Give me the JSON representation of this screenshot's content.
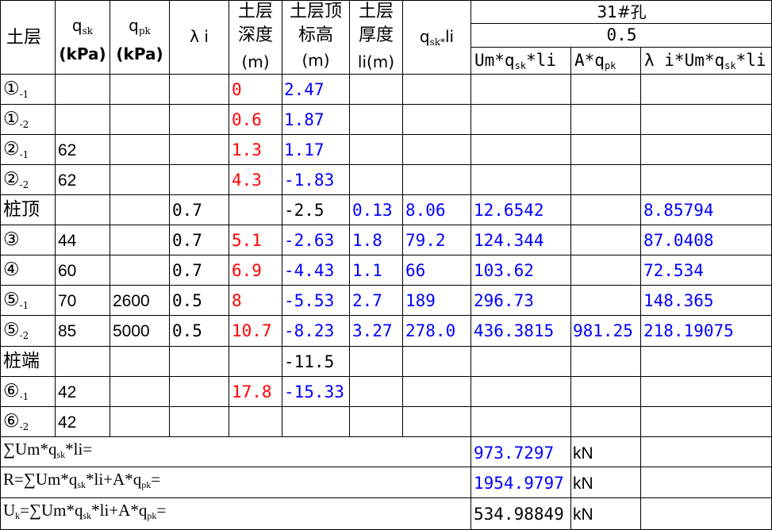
{
  "header": {
    "soil_layer": "土层",
    "qsk_top": "q",
    "qsk_sub": "sk",
    "qsk_unit": "(kPa)",
    "qpk_top": "q",
    "qpk_sub": "pk",
    "qpk_unit": "(kPa)",
    "lambda": "λ i",
    "depth_l1": "土层",
    "depth_l2": "深度",
    "depth_unit": "(m)",
    "elev_l1": "土层顶",
    "elev_l2": "标高",
    "elev_unit": "(m)",
    "thick_l1": "土层",
    "thick_l2": "厚度",
    "thick_unit": "li(m)",
    "qskli_q": "q",
    "qskli_sub": "sk*",
    "qskli_li": "li",
    "hole": "31#孔",
    "hole_value": "0.5",
    "col_um_pre": "Um*q",
    "col_um_sub": "sk",
    "col_um_post": "*li",
    "col_a_pre": "A*q",
    "col_a_sub": "pk",
    "col_lam": "λ i*Um*q",
    "col_lam_sub": "sk",
    "col_lam_post": "*li"
  },
  "rows": [
    {
      "sym": "①",
      "sub": "-1",
      "qsk": "",
      "qpk": "",
      "lam": "",
      "depth": "0",
      "elev": "2.47",
      "thick": "",
      "qskli": "",
      "um": "",
      "a": "",
      "lamum": ""
    },
    {
      "sym": "①",
      "sub": "-2",
      "qsk": "",
      "qpk": "",
      "lam": "",
      "depth": "0.6",
      "elev": "1.87",
      "thick": "",
      "qskli": "",
      "um": "",
      "a": "",
      "lamum": ""
    },
    {
      "sym": "②",
      "sub": "-1",
      "qsk": "62",
      "qpk": "",
      "lam": "",
      "depth": "1.3",
      "elev": "1.17",
      "thick": "",
      "qskli": "",
      "um": "",
      "a": "",
      "lamum": ""
    },
    {
      "sym": "②",
      "sub": "-2",
      "qsk": "62",
      "qpk": "",
      "lam": "",
      "depth": "4.3",
      "elev": "-1.83",
      "thick": "",
      "qskli": "",
      "um": "",
      "a": "",
      "lamum": ""
    },
    {
      "sym": "桩顶",
      "sub": "",
      "qsk": "",
      "qpk": "",
      "lam": "0.7",
      "depth": "",
      "elev": "-2.5",
      "thick": "0.13",
      "qskli": "8.06",
      "um": "12.6542",
      "a": "",
      "lamum": "8.85794"
    },
    {
      "sym": "③",
      "sub": "",
      "qsk": "44",
      "qpk": "",
      "lam": "0.7",
      "depth": "5.1",
      "elev": "-2.63",
      "thick": "1.8",
      "qskli": "79.2",
      "um": "124.344",
      "a": "",
      "lamum": "87.0408"
    },
    {
      "sym": "④",
      "sub": "",
      "qsk": "60",
      "qpk": "",
      "lam": "0.7",
      "depth": "6.9",
      "elev": "-4.43",
      "thick": "1.1",
      "qskli": "66",
      "um": "103.62",
      "a": "",
      "lamum": "72.534"
    },
    {
      "sym": "⑤",
      "sub": "-1",
      "qsk": "70",
      "qpk": "2600",
      "lam": "0.5",
      "depth": "8",
      "elev": "-5.53",
      "thick": "2.7",
      "qskli": "189",
      "um": "296.73",
      "a": "",
      "lamum": "148.365"
    },
    {
      "sym": "⑤",
      "sub": "-2",
      "qsk": "85",
      "qpk": "5000",
      "lam": "0.5",
      "depth": "10.7",
      "elev": "-8.23",
      "thick": "3.27",
      "qskli": "278.0",
      "um": "436.3815",
      "a": "981.25",
      "lamum": "218.19075"
    },
    {
      "sym": "桩端",
      "sub": "",
      "qsk": "",
      "qpk": "",
      "lam": "",
      "depth": "",
      "elev": "-11.5",
      "thick": "",
      "qskli": "",
      "um": "",
      "a": "",
      "lamum": ""
    },
    {
      "sym": "⑥",
      "sub": "-1",
      "qsk": "42",
      "qpk": "",
      "lam": "",
      "depth": "17.8",
      "elev": "-15.33",
      "thick": "",
      "qskli": "",
      "um": "",
      "a": "",
      "lamum": ""
    },
    {
      "sym": "⑥",
      "sub": "-2",
      "qsk": "42",
      "qpk": "",
      "lam": "",
      "depth": "",
      "elev": "",
      "thick": "",
      "qskli": "",
      "um": "",
      "a": "",
      "lamum": ""
    }
  ],
  "summary": [
    {
      "pre": "",
      "pre_sub": "",
      "label": "∑Um*q",
      "label_sub": "sk",
      "label_post": "*li=",
      "value": "973.7297",
      "unit": "kN",
      "value_color": "blue"
    },
    {
      "pre": "R=",
      "pre_sub": "",
      "label": "∑Um*q",
      "label_sub": "sk",
      "label_post": "*li+A*q",
      "label_sub2": "pk",
      "label_post2": "=",
      "value": "1954.9797",
      "unit": "kN",
      "value_color": "blue"
    },
    {
      "pre": "U",
      "pre_sub": "k",
      "label": "=∑Um*q",
      "label_sub": "sk",
      "label_post": "*li+A*q",
      "label_sub2": "pk",
      "label_post2": "=",
      "value": "534.98849",
      "unit": "kN",
      "value_color": "black"
    }
  ],
  "colors": {
    "red": "#ff0000",
    "blue": "#0000ff",
    "grid": "#000000"
  }
}
